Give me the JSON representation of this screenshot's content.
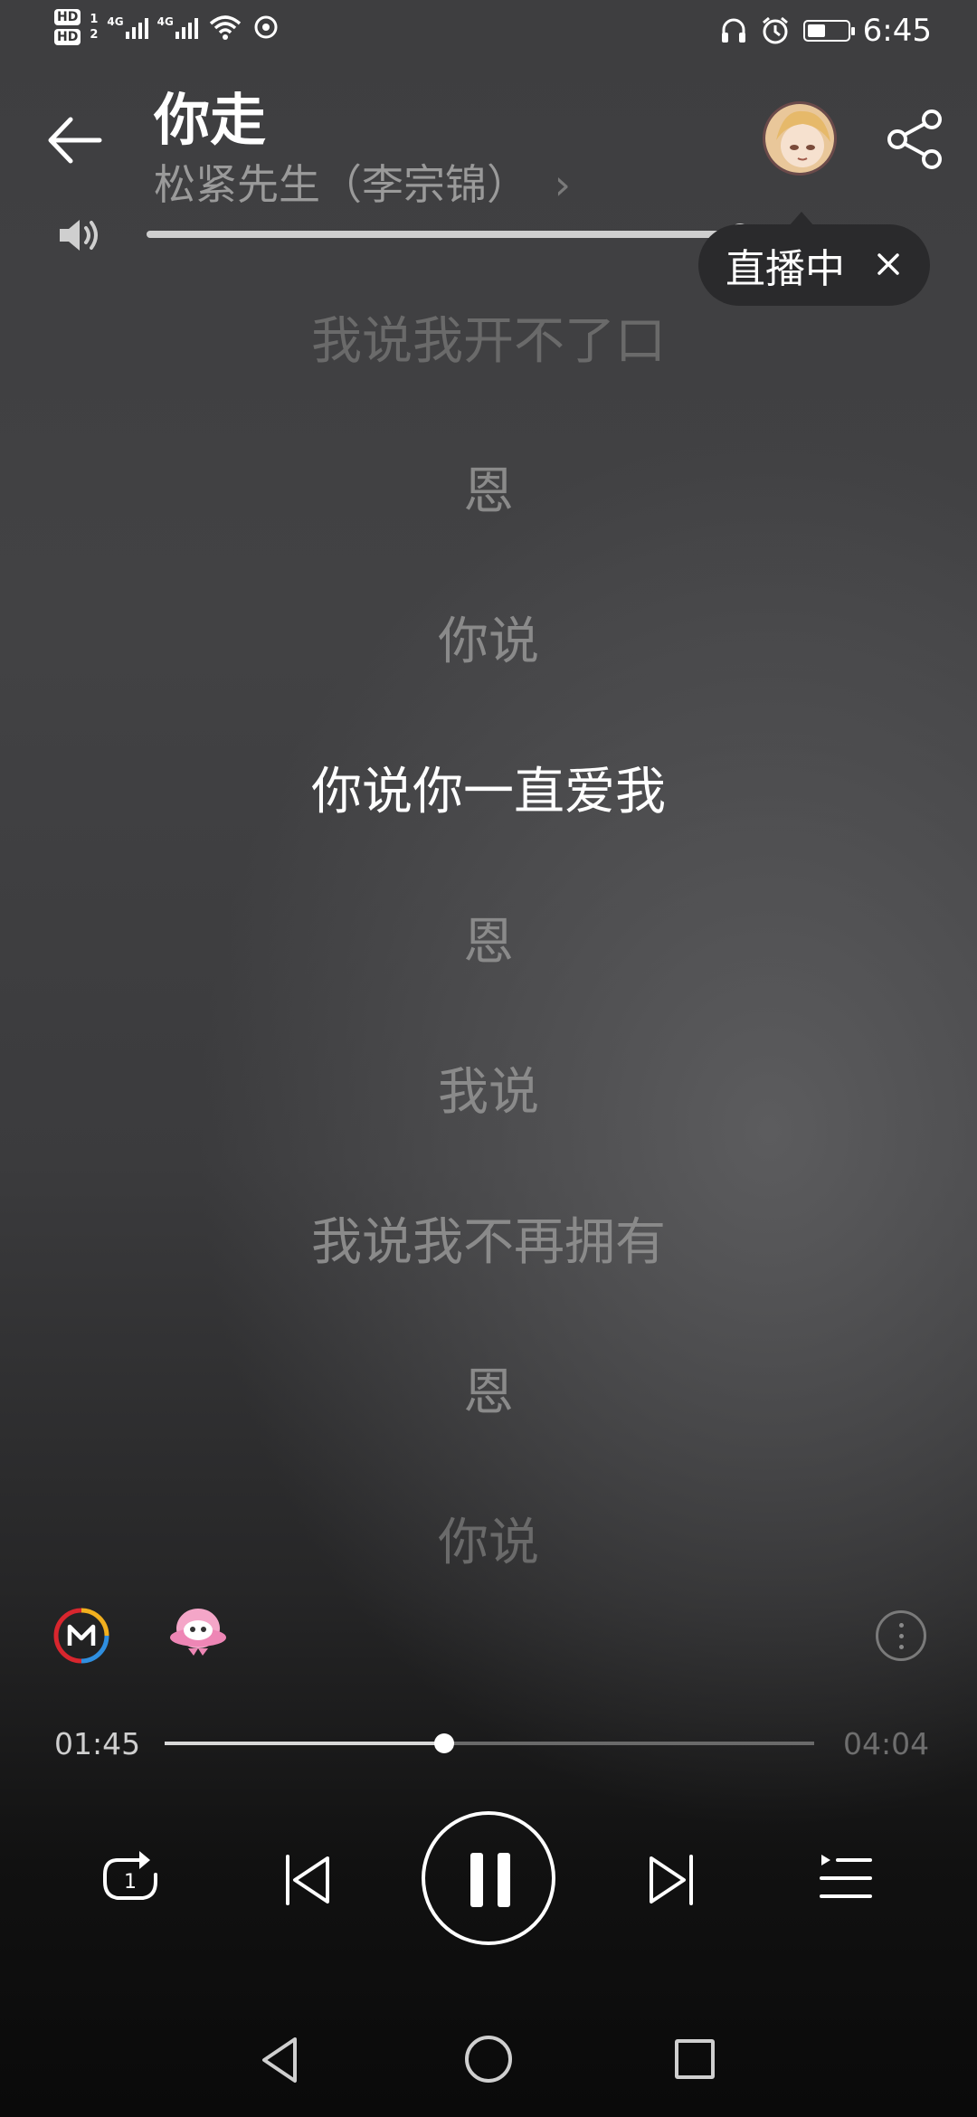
{
  "status_bar": {
    "hd_labels": [
      "HD",
      "HD"
    ],
    "sim_labels": [
      "1",
      "2"
    ],
    "network_labels": [
      "4G",
      "4G"
    ],
    "time": "6:45",
    "icons": [
      "signal-icon",
      "wifi-icon",
      "hotspot-icon",
      "headphones-icon",
      "alarm-icon",
      "battery-icon"
    ]
  },
  "header": {
    "song_title": "你走",
    "artist": "松紧先生（李宗锦）",
    "artist_chevron": "›"
  },
  "volume": {
    "level": 0.8
  },
  "live_bubble": {
    "label": "直播中"
  },
  "lyrics": [
    {
      "text": "我说我开不了口",
      "state": "dim"
    },
    {
      "text": "恩",
      "state": "normal"
    },
    {
      "text": "你说",
      "state": "normal"
    },
    {
      "text": "你说你一直爱我",
      "state": "active"
    },
    {
      "text": "恩",
      "state": "normal"
    },
    {
      "text": "我说",
      "state": "normal"
    },
    {
      "text": "我说我不再拥有",
      "state": "normal"
    },
    {
      "text": "恩",
      "state": "normal"
    },
    {
      "text": "你说",
      "state": "dim"
    }
  ],
  "progress": {
    "current": "01:45",
    "total": "04:04",
    "fraction": 0.43
  },
  "controls": {
    "repeat_mode_label": "1",
    "accent": "#ffffff"
  }
}
